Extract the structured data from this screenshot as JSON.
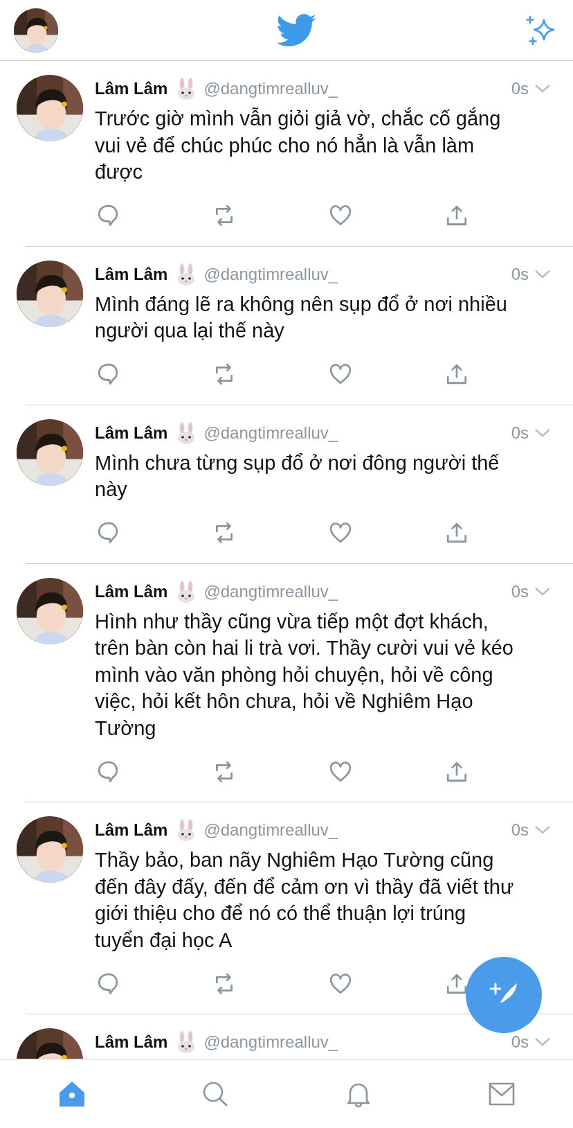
{
  "tweets": [
    {
      "name": "Lâm Lâm",
      "handle": "@dangtimrealluv_",
      "time": "0s",
      "text": "Trước giờ mình vẫn giỏi giả vờ, chắc cố gắng vui vẻ để chúc phúc cho nó hẳn là vẫn làm được"
    },
    {
      "name": "Lâm Lâm",
      "handle": "@dangtimrealluv_",
      "time": "0s",
      "text": "Mình đáng lẽ ra không nên sụp đổ ở nơi nhiều người qua lại thế này"
    },
    {
      "name": "Lâm Lâm",
      "handle": "@dangtimrealluv_",
      "time": "0s",
      "text": "Mình chưa từng sụp đổ ở nơi đông người thế này"
    },
    {
      "name": "Lâm Lâm",
      "handle": "@dangtimrealluv_",
      "time": "0s",
      "text": "Hình như thầy cũng vừa tiếp một đợt khách, trên bàn còn hai li trà vơi. Thầy cười vui vẻ kéo mình vào văn phòng hỏi chuyện, hỏi về công việc, hỏi kết hôn chưa, hỏi về Nghiêm Hạo Tường"
    },
    {
      "name": "Lâm Lâm",
      "handle": "@dangtimrealluv_",
      "time": "0s",
      "text": "Thầy bảo, ban nãy Nghiêm Hạo Tường cũng đến đây đấy, đến để cảm ơn vì thầy đã viết thư giới thiệu cho để nó có thể thuận lợi trúng tuyển đại học A"
    },
    {
      "name": "Lâm Lâm",
      "handle": "@dangtimrealluv_",
      "time": "0s"
    }
  ],
  "tabs": [
    {
      "kind": "home",
      "selected": true
    },
    {
      "kind": "search",
      "selected": false
    },
    {
      "kind": "notifications",
      "selected": false
    },
    {
      "kind": "messages",
      "selected": false
    }
  ]
}
